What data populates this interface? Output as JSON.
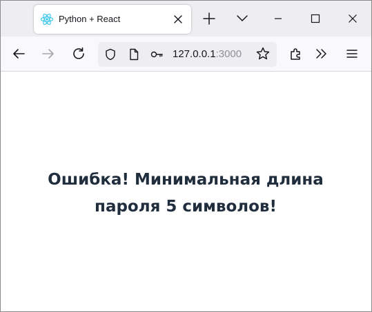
{
  "tab": {
    "title": "Python + React",
    "icon": "react-icon"
  },
  "tabstrip": {
    "new_tab_icon": "plus-icon",
    "list_tabs_icon": "chevron-down-icon",
    "window_controls": [
      "minimize-icon",
      "maximize-icon",
      "close-icon"
    ]
  },
  "toolbar": {
    "url_host": "127.0.0.1",
    "url_port": ":3000",
    "icons": [
      "back-arrow-icon",
      "forward-arrow-icon",
      "reload-icon",
      "shield-icon",
      "page-icon",
      "key-icon",
      "star-icon",
      "extensions-icon",
      "overflow-chevrons-icon",
      "menu-icon"
    ]
  },
  "content": {
    "error_message": "Ошибка! Минимальная длина пароля 5 символов!"
  },
  "colors": {
    "tabstrip_bg": "#eeedf1",
    "toolbar_bg": "#f9f9fb",
    "react_accent": "#61dafb",
    "text_dark": "#1f2d3d"
  }
}
